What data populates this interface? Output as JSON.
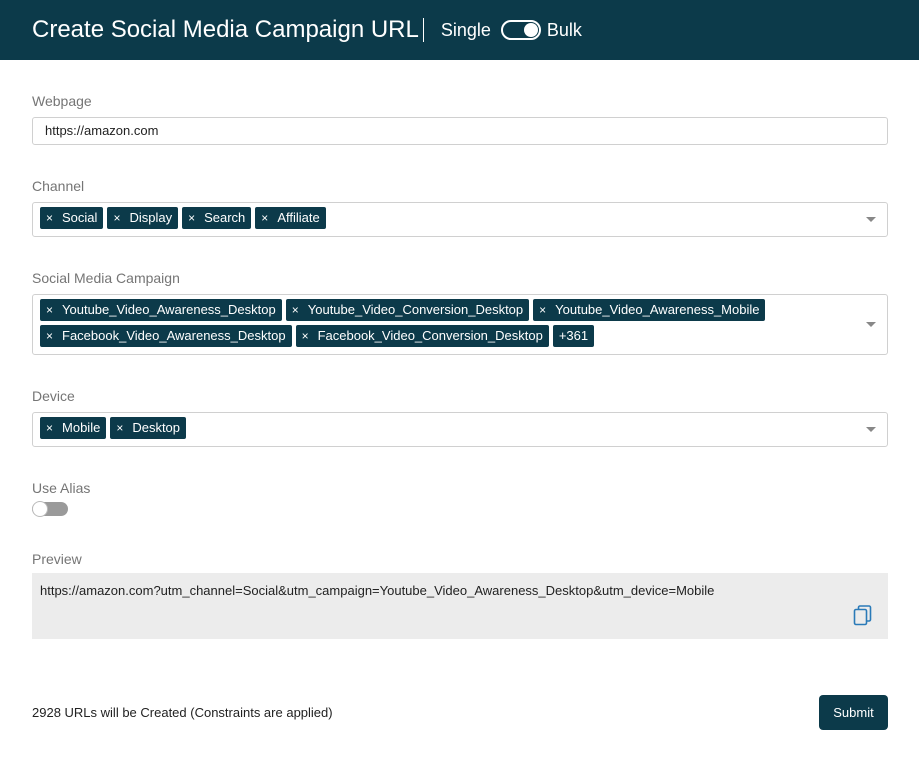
{
  "header": {
    "title": "Create Social Media Campaign URL",
    "mode_single": "Single",
    "mode_bulk": "Bulk"
  },
  "webpage": {
    "label": "Webpage",
    "value": "https://amazon.com"
  },
  "channel": {
    "label": "Channel",
    "tags": [
      "Social",
      "Display",
      "Search",
      "Affiliate"
    ]
  },
  "campaign": {
    "label": "Social Media Campaign",
    "tags": [
      "Youtube_Video_Awareness_Desktop",
      "Youtube_Video_Conversion_Desktop",
      "Youtube_Video_Awareness_Mobile",
      "Facebook_Video_Awareness_Desktop",
      "Facebook_Video_Conversion_Desktop"
    ],
    "more": "+361"
  },
  "device": {
    "label": "Device",
    "tags": [
      "Mobile",
      "Desktop"
    ]
  },
  "alias": {
    "label": "Use Alias",
    "enabled": false
  },
  "preview": {
    "label": "Preview",
    "text": "https://amazon.com?utm_channel=Social&utm_campaign=Youtube_Video_Awareness_Desktop&utm_device=Mobile"
  },
  "footer": {
    "count_text": "2928 URLs will be Created (Constraints are applied)",
    "submit_label": "Submit"
  },
  "icons": {
    "remove_glyph": "×",
    "copy": "copy-icon",
    "dropdown": "chevron-down-icon"
  },
  "colors": {
    "brand": "#0c3a4a",
    "copy_icon": "#2a7ab8",
    "preview_bg": "#ececec"
  }
}
